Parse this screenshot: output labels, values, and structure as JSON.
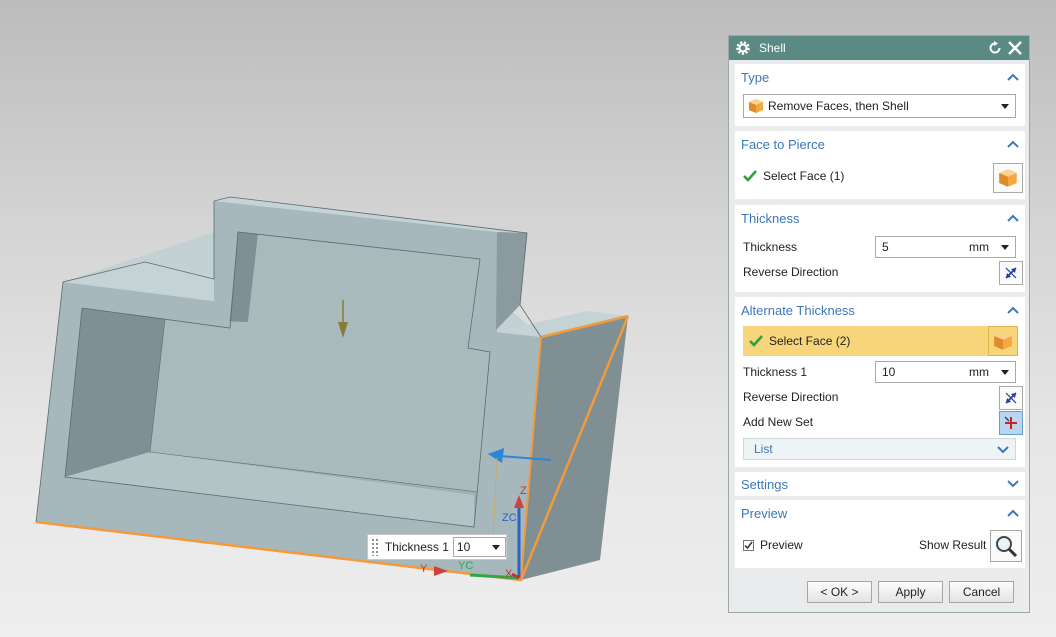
{
  "float_widget": {
    "label": "Thickness 1",
    "value": "10"
  },
  "triad": {
    "zc": "ZC",
    "yc": "YC",
    "z": "Z",
    "y": "Y",
    "x": "X"
  },
  "dialog": {
    "title": "Shell",
    "type_section": {
      "heading": "Type",
      "selected": "Remove Faces, then Shell"
    },
    "face_section": {
      "heading": "Face to Pierce",
      "select_label": "Select Face (1)"
    },
    "thickness_section": {
      "heading": "Thickness",
      "thickness_label": "Thickness",
      "thickness_value": "5",
      "thickness_unit": "mm",
      "reverse_label": "Reverse Direction"
    },
    "alt_section": {
      "heading": "Alternate Thickness",
      "select_label": "Select Face (2)",
      "thickness_label": "Thickness 1",
      "thickness_value": "10",
      "thickness_unit": "mm",
      "reverse_label": "Reverse Direction",
      "add_label": "Add New Set",
      "list_label": "List"
    },
    "settings_section": {
      "heading": "Settings"
    },
    "preview_section": {
      "heading": "Preview",
      "preview_label": "Preview",
      "preview_checked": true,
      "show_result_label": "Show Result"
    },
    "buttons": {
      "ok": "< OK >",
      "apply": "Apply",
      "cancel": "Cancel"
    }
  },
  "colors": {
    "title_bar": "#5b8a83",
    "section_heading": "#3b78b8",
    "highlight": "#f7d57a",
    "edge_highlight": "#f29a3c",
    "model_face": "#a7b8bc"
  },
  "icons": [
    "gear-icon",
    "reset-icon",
    "close-icon",
    "chevron-up-icon",
    "chevron-down-icon",
    "block-icon",
    "check-icon",
    "reverse-icon",
    "add-set-icon",
    "magnifier-icon"
  ]
}
